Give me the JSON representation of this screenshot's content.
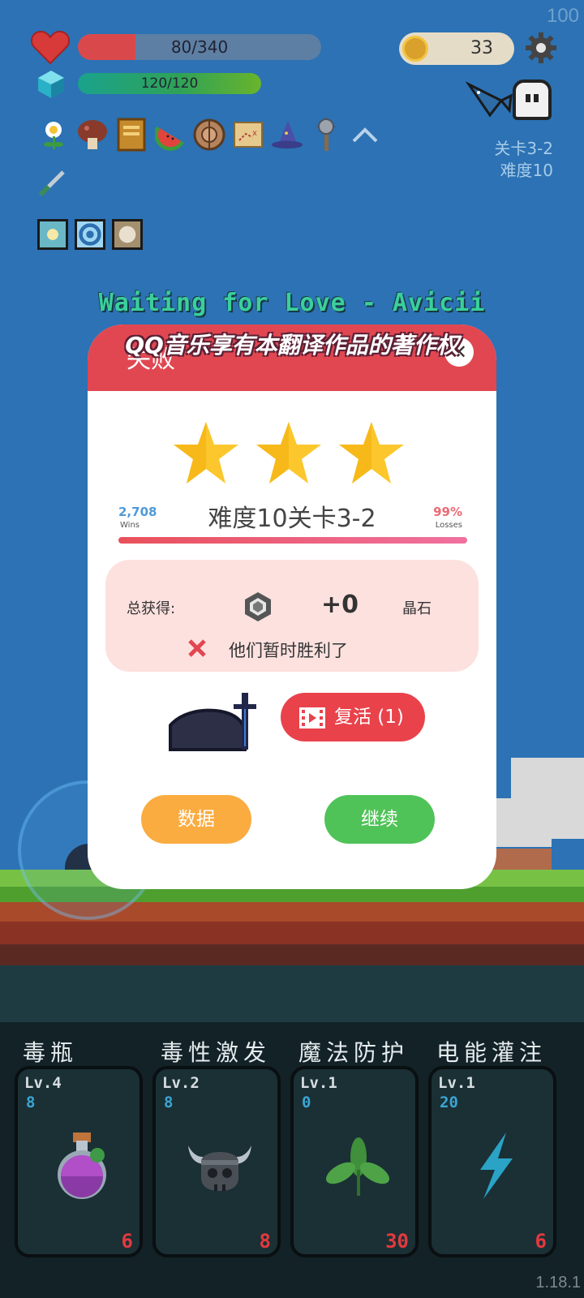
{
  "hud": {
    "fps": "100",
    "hp_text": "80/340",
    "hp_ratio": 0.235,
    "mp_text": "120/120",
    "coins": "33",
    "stage_line": "关卡3-2",
    "difficulty_line": "难度10",
    "items": [
      "flower",
      "mushroom",
      "book",
      "watermelon",
      "shield",
      "map",
      "wizard-hat",
      "mace"
    ]
  },
  "lyrics": {
    "line1": "Waiting for Love - Avicii",
    "line2": "QQ音乐享有本翻译作品的著作权"
  },
  "dialog": {
    "title": "失败",
    "close": "✕",
    "stars": 3,
    "wins_value": "2,708",
    "wins_label": "Wins",
    "losses_value": "99%",
    "losses_label": "Losses",
    "stage_title": "难度10关卡3-2",
    "reward_label": "总获得:",
    "reward_amount": "+0",
    "reward_unit": "晶石",
    "result_message": "他们暂时胜利了",
    "revive_label": "复活 (1)",
    "stats_button": "数据",
    "continue_button": "继续"
  },
  "skills": [
    {
      "name": "毒瓶",
      "level": "Lv.4",
      "cost": "8",
      "count": "6",
      "icon": "potion-icon"
    },
    {
      "name": "毒性激发",
      "level": "Lv.2",
      "cost": "8",
      "count": "8",
      "icon": "viking-skull-icon"
    },
    {
      "name": "魔法防护",
      "level": "Lv.1",
      "cost": "0",
      "count": "30",
      "icon": "leaf-icon"
    },
    {
      "name": "电能灌注",
      "level": "Lv.1",
      "cost": "20",
      "count": "6",
      "icon": "lightning-icon"
    }
  ],
  "version": "1.18.1",
  "colors": {
    "sky": "#2c72b4",
    "dialog_header": "#e14751",
    "star": "#fbc72d",
    "data_button": "#fbac40",
    "continue_button": "#50c358"
  }
}
